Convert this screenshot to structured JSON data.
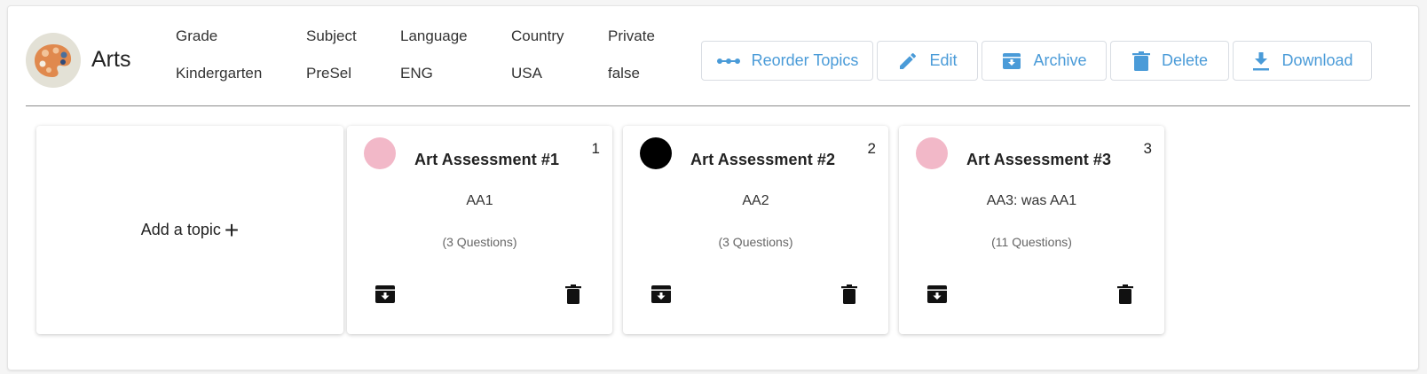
{
  "header": {
    "title": "Arts",
    "meta": [
      {
        "label": "Grade",
        "value": "Kindergarten"
      },
      {
        "label": "Subject",
        "value": "PreSel"
      },
      {
        "label": "Language",
        "value": "ENG"
      },
      {
        "label": "Country",
        "value": "USA"
      },
      {
        "label": "Private",
        "value": "false"
      }
    ],
    "avatar_icon": "palette-icon"
  },
  "actions": {
    "reorder_label": "Reorder Topics",
    "edit_label": "Edit",
    "archive_label": "Archive",
    "delete_label": "Delete",
    "download_label": "Download",
    "accent_color": "#4a9bd8"
  },
  "add_topic": {
    "label": "Add a topic",
    "icon": "+"
  },
  "topics": [
    {
      "number": "1",
      "title": "Art Assessment #1",
      "code": "AA1",
      "count": "(3 Questions)",
      "color": "#f2b8c8"
    },
    {
      "number": "2",
      "title": "Art Assessment #2",
      "code": "AA2",
      "count": "(3 Questions)",
      "color": "#000000"
    },
    {
      "number": "3",
      "title": "Art Assessment #3",
      "code": "AA3: was AA1",
      "count": "(11 Questions)",
      "color": "#f2b8c8"
    }
  ]
}
